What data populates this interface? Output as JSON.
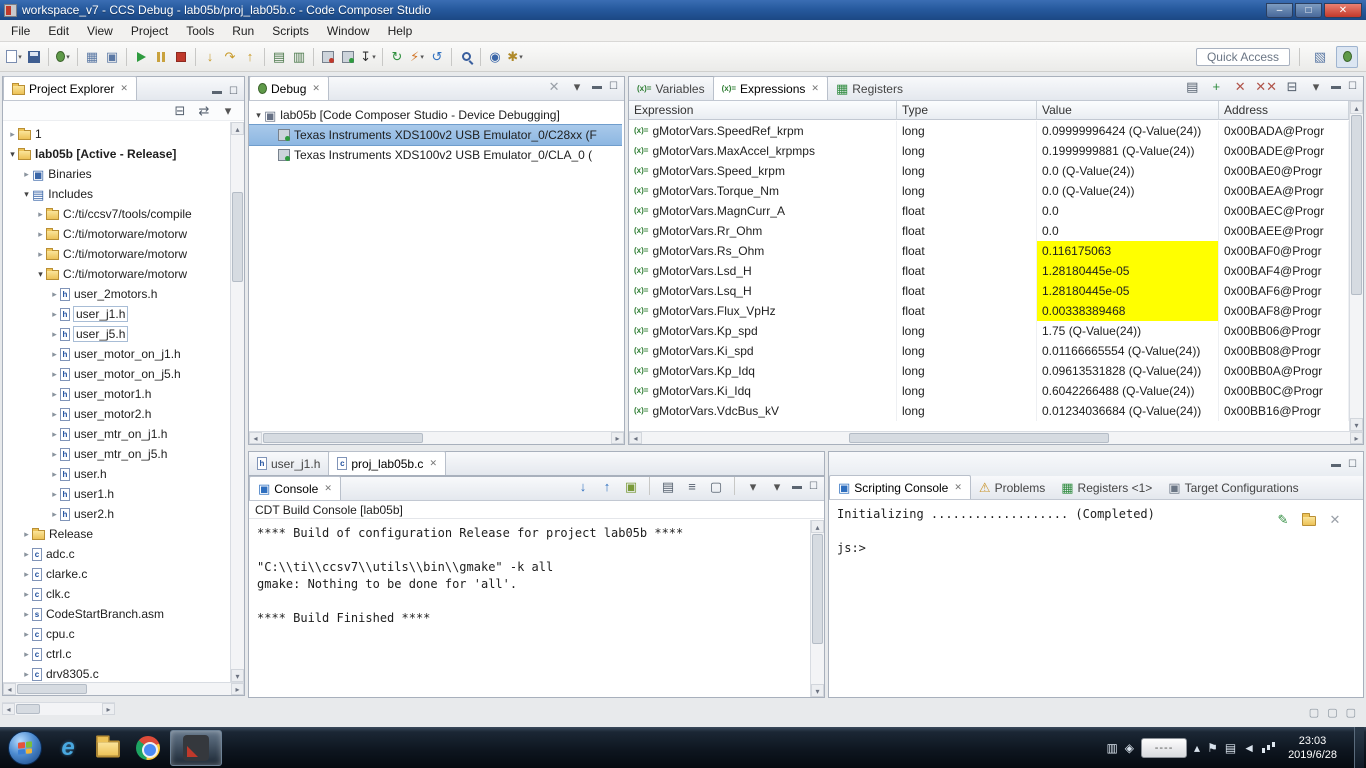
{
  "window": {
    "title": "workspace_v7 - CCS Debug - lab05b/proj_lab05b.c - Code Composer Studio",
    "controls": {
      "minimize": "–",
      "restore": "□",
      "close": "✕"
    }
  },
  "colors": {
    "titlebar": "#275a9e",
    "value_highlight": "#ffff00",
    "selection": "#8db7e2"
  },
  "menu": {
    "items": [
      "File",
      "Edit",
      "View",
      "Project",
      "Tools",
      "Run",
      "Scripts",
      "Window",
      "Help"
    ]
  },
  "toolbar": {
    "quick_access": "Quick Access",
    "icons": [
      {
        "n": "new-file",
        "cls": "mi-file",
        "dd": true
      },
      {
        "n": "save",
        "cls": "mi-floppy"
      },
      {
        "sep": true
      },
      {
        "n": "debug",
        "cls": "mi-bug",
        "dd": true
      },
      {
        "sep": true
      },
      {
        "n": "view-grid",
        "g": "▦",
        "col": "#5b79a5"
      },
      {
        "n": "target-configurations",
        "g": "▣",
        "col": "#5b79a5"
      },
      {
        "sep": true
      },
      {
        "n": "resume",
        "cls": "mi-play"
      },
      {
        "n": "suspend",
        "cls": "mi-pause"
      },
      {
        "n": "terminate",
        "cls": "mi-stop"
      },
      {
        "sep": true
      },
      {
        "n": "step-into",
        "g": "↓",
        "col": "#c89a28"
      },
      {
        "n": "step-over",
        "g": "↷",
        "col": "#c89a28"
      },
      {
        "n": "step-return",
        "g": "↑",
        "col": "#c89a28"
      },
      {
        "sep": true
      },
      {
        "n": "registers-view",
        "g": "▤",
        "col": "#4d7a4d"
      },
      {
        "n": "memory-view",
        "g": "▥",
        "col": "#4d7a4d"
      },
      {
        "sep": true
      },
      {
        "n": "connect-target",
        "cls": "mi-chip-red"
      },
      {
        "n": "disconnect-target",
        "cls": "mi-chip-green"
      },
      {
        "n": "load-program",
        "g": "↧",
        "col": "#333333",
        "dd": true
      },
      {
        "sep": true
      },
      {
        "n": "refresh",
        "g": "↻",
        "col": "#2f8f3e"
      },
      {
        "n": "flash",
        "g": "⚡",
        "col": "#d2772a",
        "dd": true
      },
      {
        "n": "restart",
        "g": "↺",
        "col": "#2f6fbf"
      },
      {
        "sep": true
      },
      {
        "n": "search",
        "cls": "mi-search"
      },
      {
        "sep": true
      },
      {
        "n": "breakpoints",
        "g": "◉",
        "col": "#3a66a8"
      },
      {
        "n": "new-wizard",
        "g": "✱",
        "col": "#b08a2a",
        "dd": true
      }
    ]
  },
  "project_explorer": {
    "title": "Project Explorer",
    "tools": [
      {
        "n": "collapse-all",
        "g": "⊟",
        "col": "#55606e"
      },
      {
        "n": "link-with-editor",
        "g": "⇄",
        "col": "#55606e"
      },
      {
        "n": "view-menu",
        "g": "▾",
        "col": "#555555"
      }
    ],
    "items": [
      {
        "t": "1",
        "l": 0,
        "tw": "c",
        "ic": "project"
      },
      {
        "t": "lab05b [Active - Release]",
        "l": 0,
        "tw": "o",
        "ic": "project",
        "b": true
      },
      {
        "t": "Binaries",
        "l": 1,
        "tw": "c",
        "ic": "binaries"
      },
      {
        "t": "Includes",
        "l": 1,
        "tw": "o",
        "ic": "includes"
      },
      {
        "t": "C:/ti/ccsv7/tools/compile",
        "l": 2,
        "tw": "c",
        "ic": "incdir"
      },
      {
        "t": "C:/ti/motorware/motorw",
        "l": 2,
        "tw": "c",
        "ic": "incdir"
      },
      {
        "t": "C:/ti/motorware/motorw",
        "l": 2,
        "tw": "c",
        "ic": "incdir"
      },
      {
        "t": "C:/ti/motorware/motorw",
        "l": 2,
        "tw": "o",
        "ic": "incdir"
      },
      {
        "t": "user_2motors.h",
        "l": 3,
        "tw": "c",
        "ic": "h"
      },
      {
        "t": "user_j1.h",
        "l": 3,
        "tw": "c",
        "ic": "h",
        "box": true
      },
      {
        "t": "user_j5.h",
        "l": 3,
        "tw": "c",
        "ic": "h",
        "box": true
      },
      {
        "t": "user_motor_on_j1.h",
        "l": 3,
        "tw": "c",
        "ic": "h"
      },
      {
        "t": "user_motor_on_j5.h",
        "l": 3,
        "tw": "c",
        "ic": "h"
      },
      {
        "t": "user_motor1.h",
        "l": 3,
        "tw": "c",
        "ic": "h"
      },
      {
        "t": "user_motor2.h",
        "l": 3,
        "tw": "c",
        "ic": "h"
      },
      {
        "t": "user_mtr_on_j1.h",
        "l": 3,
        "tw": "c",
        "ic": "h"
      },
      {
        "t": "user_mtr_on_j5.h",
        "l": 3,
        "tw": "c",
        "ic": "h"
      },
      {
        "t": "user.h",
        "l": 3,
        "tw": "c",
        "ic": "h"
      },
      {
        "t": "user1.h",
        "l": 3,
        "tw": "c",
        "ic": "h"
      },
      {
        "t": "user2.h",
        "l": 3,
        "tw": "c",
        "ic": "h"
      },
      {
        "t": "Release",
        "l": 1,
        "tw": "c",
        "ic": "folder"
      },
      {
        "t": "adc.c",
        "l": 1,
        "tw": "c",
        "ic": "c"
      },
      {
        "t": "clarke.c",
        "l": 1,
        "tw": "c",
        "ic": "c"
      },
      {
        "t": "clk.c",
        "l": 1,
        "tw": "c",
        "ic": "c"
      },
      {
        "t": "CodeStartBranch.asm",
        "l": 1,
        "tw": "c",
        "ic": "s"
      },
      {
        "t": "cpu.c",
        "l": 1,
        "tw": "c",
        "ic": "c"
      },
      {
        "t": "ctrl.c",
        "l": 1,
        "tw": "c",
        "ic": "c"
      },
      {
        "t": "drv8305.c",
        "l": 1,
        "tw": "c",
        "ic": "c"
      }
    ]
  },
  "debug": {
    "title": "Debug",
    "tools": [
      {
        "n": "remove-all-terminated",
        "g": "✕",
        "col": "#9aa0a8"
      },
      {
        "n": "view-menu",
        "g": "▾",
        "col": "#555555"
      }
    ],
    "items": [
      {
        "t": "lab05b [Code Composer Studio - Device Debugging]",
        "l": 0,
        "tw": "o",
        "ic": "debug-root"
      },
      {
        "t": "Texas Instruments XDS100v2 USB Emulator_0/C28xx (F",
        "l": 1,
        "ic": "core",
        "sel": true
      },
      {
        "t": "Texas Instruments XDS100v2 USB Emulator_0/CLA_0 (",
        "l": 1,
        "ic": "core"
      }
    ]
  },
  "expressions": {
    "tabs": [
      {
        "label": "Variables",
        "icon": "varexp"
      },
      {
        "label": "Expressions",
        "icon": "varexp",
        "active": true,
        "close": true
      },
      {
        "label": "Registers",
        "icon": "reg"
      }
    ],
    "tools": [
      {
        "n": "show-type-names",
        "g": "▤",
        "col": "#55606e"
      },
      {
        "n": "add-expression",
        "g": "+",
        "col": "#2e8b3e"
      },
      {
        "n": "remove-expression",
        "g": "✕",
        "col": "#b0544a"
      },
      {
        "n": "remove-all-expressions",
        "g": "✕✕",
        "col": "#b0544a"
      },
      {
        "n": "collapse-all",
        "g": "⊟",
        "col": "#55606e"
      },
      {
        "n": "view-menu",
        "g": "▾",
        "col": "#555555"
      }
    ],
    "columns": [
      "Expression",
      "Type",
      "Value",
      "Address"
    ],
    "rows": [
      {
        "e": "gMotorVars.SpeedRef_krpm",
        "t": "long",
        "v": "0.09999996424 (Q-Value(24))",
        "a": "0x00BADA@Progr",
        "hl": false
      },
      {
        "e": "gMotorVars.MaxAccel_krpmps",
        "t": "long",
        "v": "0.1999999881 (Q-Value(24))",
        "a": "0x00BADE@Progr",
        "hl": false
      },
      {
        "e": "gMotorVars.Speed_krpm",
        "t": "long",
        "v": "0.0 (Q-Value(24))",
        "a": "0x00BAE0@Progr",
        "hl": false
      },
      {
        "e": "gMotorVars.Torque_Nm",
        "t": "long",
        "v": "0.0 (Q-Value(24))",
        "a": "0x00BAEA@Progr",
        "hl": false
      },
      {
        "e": "gMotorVars.MagnCurr_A",
        "t": "float",
        "v": "0.0",
        "a": "0x00BAEC@Progr",
        "hl": false
      },
      {
        "e": "gMotorVars.Rr_Ohm",
        "t": "float",
        "v": "0.0",
        "a": "0x00BAEE@Progr",
        "hl": false
      },
      {
        "e": "gMotorVars.Rs_Ohm",
        "t": "float",
        "v": "0.116175063",
        "a": "0x00BAF0@Progr",
        "hl": true
      },
      {
        "e": "gMotorVars.Lsd_H",
        "t": "float",
        "v": "1.28180445e-05",
        "a": "0x00BAF4@Progr",
        "hl": true
      },
      {
        "e": "gMotorVars.Lsq_H",
        "t": "float",
        "v": "1.28180445e-05",
        "a": "0x00BAF6@Progr",
        "hl": true
      },
      {
        "e": "gMotorVars.Flux_VpHz",
        "t": "float",
        "v": "0.00338389468",
        "a": "0x00BAF8@Progr",
        "hl": true
      },
      {
        "e": "gMotorVars.Kp_spd",
        "t": "long",
        "v": "1.75 (Q-Value(24))",
        "a": "0x00BB06@Progr",
        "hl": false
      },
      {
        "e": "gMotorVars.Ki_spd",
        "t": "long",
        "v": "0.01166665554 (Q-Value(24))",
        "a": "0x00BB08@Progr",
        "hl": false
      },
      {
        "e": "gMotorVars.Kp_Idq",
        "t": "long",
        "v": "0.09613531828 (Q-Value(24))",
        "a": "0x00BB0A@Progr",
        "hl": false
      },
      {
        "e": "gMotorVars.Ki_Idq",
        "t": "long",
        "v": "0.6042266488 (Q-Value(24))",
        "a": "0x00BB0C@Progr",
        "hl": false
      },
      {
        "e": "gMotorVars.VdcBus_kV",
        "t": "long",
        "v": "0.01234036684 (Q-Value(24))",
        "a": "0x00BB16@Progr",
        "hl": false
      }
    ]
  },
  "editor": {
    "tabs": [
      {
        "label": "user_j1.h",
        "icon": "h"
      },
      {
        "label": "proj_lab05b.c",
        "icon": "c",
        "active": true,
        "close": true
      }
    ]
  },
  "console": {
    "tab": "Console",
    "subtitle": "CDT Build Console [lab05b]",
    "tools": [
      {
        "n": "scroll-to-end",
        "g": "↓",
        "col": "#2f6fbf"
      },
      {
        "n": "scroll-to-previous",
        "g": "↑",
        "col": "#2f6fbf"
      },
      {
        "n": "activate-on-output",
        "g": "▣",
        "col": "#7a9a3a"
      },
      {
        "sep": true
      },
      {
        "n": "pin-console",
        "g": "▤",
        "col": "#55606e"
      },
      {
        "n": "word-wrap",
        "g": "≡",
        "col": "#55606e"
      },
      {
        "n": "clear-console",
        "g": "▢",
        "col": "#55606e"
      },
      {
        "sep": true
      },
      {
        "n": "display-selected-console",
        "g": "▾",
        "col": "#555555"
      },
      {
        "n": "open-console",
        "g": "▾",
        "col": "#555555"
      }
    ],
    "lines": [
      "**** Build of configuration Release for project lab05b ****",
      "",
      "\"C:\\\\ti\\\\ccsv7\\\\utils\\\\bin\\\\gmake\" -k all",
      "gmake: Nothing to be done for 'all'.",
      "",
      "**** Build Finished ****"
    ]
  },
  "bottom_right": {
    "tabs": [
      {
        "label": "Scripting Console",
        "icon": "script",
        "active": true,
        "close": true
      },
      {
        "label": "Problems",
        "icon": "problems"
      },
      {
        "label": "Registers <1>",
        "icon": "reg"
      },
      {
        "label": "Target Configurations",
        "icon": "target"
      }
    ],
    "tools": [
      {
        "n": "insert-script",
        "g": "✎",
        "col": "#2e8b3e"
      },
      {
        "n": "open-command-file",
        "cls": "mi-folder"
      },
      {
        "n": "clear-script-console",
        "g": "✕",
        "col": "#9aa0a8"
      }
    ],
    "lines": [
      "Initializing ................... (Completed)",
      "",
      "js:>"
    ]
  },
  "taskbar": {
    "time": "23:03",
    "date": "2019/6/28",
    "input_panel": "----"
  }
}
